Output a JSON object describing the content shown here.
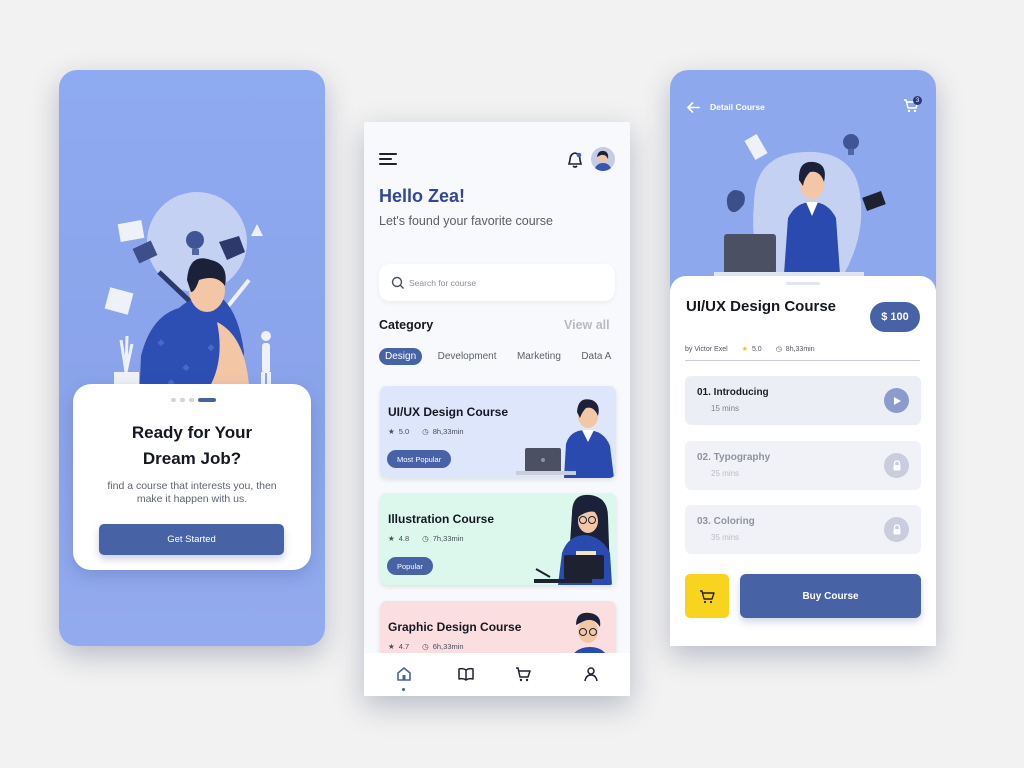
{
  "colors": {
    "primary": "#4862a6",
    "hero_blue": "#8ea8ee",
    "accent_yellow": "#f8d41f",
    "greeting_blue": "#30479a"
  },
  "onboarding": {
    "title": "Ready for Your Dream Job?",
    "description": "find a course that interests you, then make it happen with us.",
    "cta_label": "Get Started",
    "page_indicator": {
      "count": 4,
      "active": 4
    }
  },
  "home": {
    "greeting": "Hello Zea!",
    "subtitle": "Let's found your favorite course",
    "search_placeholder": "Search for course",
    "category_title": "Category",
    "view_all_label": "View all",
    "categories": [
      "Design",
      "Development",
      "Marketing",
      "Data A"
    ],
    "active_category": "Design",
    "courses": [
      {
        "title": "UI/UX Design Course",
        "rating": "5.0",
        "duration": "8h,33min",
        "badge": "Most Popular",
        "bg": "#dde6fb"
      },
      {
        "title": "Illustration Course",
        "rating": "4.8",
        "duration": "7h,33min",
        "badge": "Popular",
        "bg": "#dcf7ec"
      },
      {
        "title": "Graphic Design Course",
        "rating": "4.7",
        "duration": "6h,33min",
        "badge": "",
        "bg": "#fbdfe0"
      }
    ],
    "tabbar": [
      "home-icon",
      "book-icon",
      "cart-icon",
      "user-icon"
    ]
  },
  "detail": {
    "header_label": "Detail Course",
    "cart_count": "3",
    "title": "UI/UX Design Course",
    "price": "$ 100",
    "author": "by Victor Exel",
    "rating": "5.0",
    "duration": "8h,33min",
    "lessons": [
      {
        "title": "01. Introducing",
        "duration": "15 mins",
        "state": "play"
      },
      {
        "title": "02. Typography",
        "duration": "25 mins",
        "state": "locked"
      },
      {
        "title": "03. Coloring",
        "duration": "35 mins",
        "state": "locked"
      }
    ],
    "buy_label": "Buy Course"
  }
}
